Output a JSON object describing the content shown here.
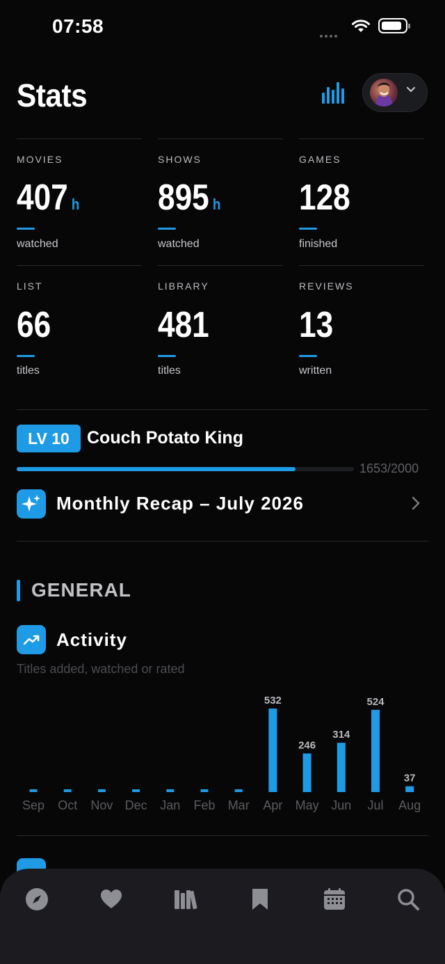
{
  "status_bar": {
    "time": "07:58"
  },
  "header": {
    "title": "Stats"
  },
  "stats": [
    {
      "label": "MOVIES",
      "value": "407",
      "unit": "h",
      "sub": "watched"
    },
    {
      "label": "SHOWS",
      "value": "895",
      "unit": "h",
      "sub": "watched"
    },
    {
      "label": "GAMES",
      "value": "128",
      "unit": "",
      "sub": "finished"
    },
    {
      "label": "LIST",
      "value": "66",
      "unit": "",
      "sub": "titles"
    },
    {
      "label": "LIBRARY",
      "value": "481",
      "unit": "",
      "sub": "titles"
    },
    {
      "label": "REVIEWS",
      "value": "13",
      "unit": "",
      "sub": "written"
    }
  ],
  "level": {
    "badge": "LV 10",
    "title": "Couch Potato King",
    "progress_text": "1653/2000",
    "current": 1653,
    "max": 2000
  },
  "recap": {
    "title": "Monthly Recap – July 2026"
  },
  "section": {
    "title": "GENERAL"
  },
  "activity": {
    "title": "Activity",
    "subtitle": "Titles added, watched or rated"
  },
  "chart_data": {
    "type": "bar",
    "categories": [
      "Sep",
      "Oct",
      "Nov",
      "Dec",
      "Jan",
      "Feb",
      "Mar",
      "Apr",
      "May",
      "Jun",
      "Jul",
      "Aug"
    ],
    "values": [
      0,
      0,
      0,
      0,
      0,
      0,
      0,
      532,
      246,
      314,
      524,
      37
    ],
    "value_labels": [
      "",
      "",
      "",
      "",
      "",
      "",
      "",
      "532",
      "246",
      "314",
      "524",
      "37"
    ],
    "title": "",
    "xlabel": "",
    "ylabel": "",
    "ylim": [
      0,
      532
    ],
    "grid": false,
    "color": "#1e9be4"
  },
  "colors": {
    "accent": "#1e9be4",
    "background": "#070708",
    "tabbar": "#1c1c20"
  },
  "tabbar": {
    "items": [
      {
        "name": "explore",
        "icon": "compass-icon"
      },
      {
        "name": "favorites",
        "icon": "heart-icon"
      },
      {
        "name": "library",
        "icon": "books-icon"
      },
      {
        "name": "watchlist",
        "icon": "bookmark-icon"
      },
      {
        "name": "calendar",
        "icon": "calendar-icon"
      },
      {
        "name": "search",
        "icon": "search-icon"
      }
    ]
  }
}
